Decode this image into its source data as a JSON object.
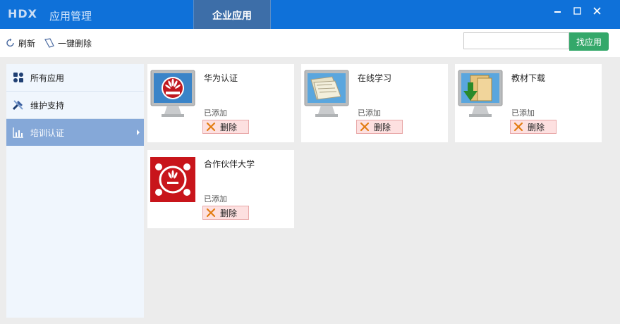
{
  "window": {
    "logo_text": "HDX",
    "title": "应用管理",
    "active_tab": "企业应用"
  },
  "toolbar": {
    "refresh_label": "刷新",
    "delete_all_label": "一键删除",
    "search_placeholder": "",
    "search_value": "",
    "search_button_label": "找应用"
  },
  "sidebar": {
    "items": [
      {
        "label": "所有应用",
        "icon": "apps-grid-icon",
        "active": false
      },
      {
        "label": "维护支持",
        "icon": "tools-icon",
        "active": false
      },
      {
        "label": "培训认证",
        "icon": "bar-chart-icon",
        "active": true
      }
    ]
  },
  "apps": [
    {
      "name": "华为认证",
      "status": "已添加",
      "delete_label": "删除",
      "icon": "huawei-monitor-icon"
    },
    {
      "name": "在线学习",
      "status": "已添加",
      "delete_label": "删除",
      "icon": "documents-monitor-icon"
    },
    {
      "name": "教材下载",
      "status": "已添加",
      "delete_label": "删除",
      "icon": "download-monitor-icon"
    },
    {
      "name": "合作伙伴大学",
      "status": "已添加",
      "delete_label": "删除",
      "icon": "huawei-university-icon"
    }
  ],
  "colors": {
    "titlebar": "#0f71d9",
    "active_tab": "#3d6ea8",
    "search_button": "#34a86a",
    "sidebar_bg": "#f0f6fd",
    "sidebar_active": "#85a8d8",
    "delete_bg": "#fde0e0"
  }
}
